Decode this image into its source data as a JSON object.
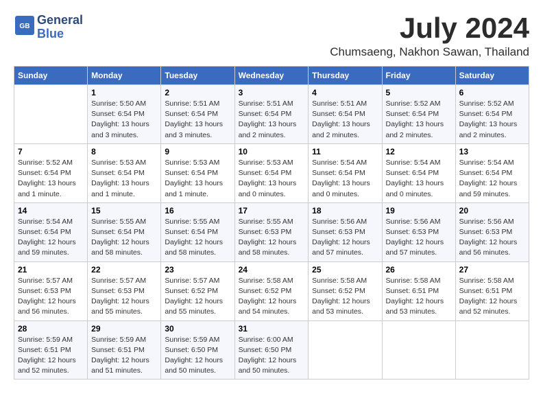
{
  "header": {
    "logo_line1": "General",
    "logo_line2": "Blue",
    "month_year": "July 2024",
    "location": "Chumsaeng, Nakhon Sawan, Thailand"
  },
  "weekdays": [
    "Sunday",
    "Monday",
    "Tuesday",
    "Wednesday",
    "Thursday",
    "Friday",
    "Saturday"
  ],
  "weeks": [
    [
      {
        "day": "",
        "info": ""
      },
      {
        "day": "1",
        "info": "Sunrise: 5:50 AM\nSunset: 6:54 PM\nDaylight: 13 hours\nand 3 minutes."
      },
      {
        "day": "2",
        "info": "Sunrise: 5:51 AM\nSunset: 6:54 PM\nDaylight: 13 hours\nand 3 minutes."
      },
      {
        "day": "3",
        "info": "Sunrise: 5:51 AM\nSunset: 6:54 PM\nDaylight: 13 hours\nand 2 minutes."
      },
      {
        "day": "4",
        "info": "Sunrise: 5:51 AM\nSunset: 6:54 PM\nDaylight: 13 hours\nand 2 minutes."
      },
      {
        "day": "5",
        "info": "Sunrise: 5:52 AM\nSunset: 6:54 PM\nDaylight: 13 hours\nand 2 minutes."
      },
      {
        "day": "6",
        "info": "Sunrise: 5:52 AM\nSunset: 6:54 PM\nDaylight: 13 hours\nand 2 minutes."
      }
    ],
    [
      {
        "day": "7",
        "info": "Sunrise: 5:52 AM\nSunset: 6:54 PM\nDaylight: 13 hours\nand 1 minute."
      },
      {
        "day": "8",
        "info": "Sunrise: 5:53 AM\nSunset: 6:54 PM\nDaylight: 13 hours\nand 1 minute."
      },
      {
        "day": "9",
        "info": "Sunrise: 5:53 AM\nSunset: 6:54 PM\nDaylight: 13 hours\nand 1 minute."
      },
      {
        "day": "10",
        "info": "Sunrise: 5:53 AM\nSunset: 6:54 PM\nDaylight: 13 hours\nand 0 minutes."
      },
      {
        "day": "11",
        "info": "Sunrise: 5:54 AM\nSunset: 6:54 PM\nDaylight: 13 hours\nand 0 minutes."
      },
      {
        "day": "12",
        "info": "Sunrise: 5:54 AM\nSunset: 6:54 PM\nDaylight: 13 hours\nand 0 minutes."
      },
      {
        "day": "13",
        "info": "Sunrise: 5:54 AM\nSunset: 6:54 PM\nDaylight: 12 hours\nand 59 minutes."
      }
    ],
    [
      {
        "day": "14",
        "info": "Sunrise: 5:54 AM\nSunset: 6:54 PM\nDaylight: 12 hours\nand 59 minutes."
      },
      {
        "day": "15",
        "info": "Sunrise: 5:55 AM\nSunset: 6:54 PM\nDaylight: 12 hours\nand 58 minutes."
      },
      {
        "day": "16",
        "info": "Sunrise: 5:55 AM\nSunset: 6:54 PM\nDaylight: 12 hours\nand 58 minutes."
      },
      {
        "day": "17",
        "info": "Sunrise: 5:55 AM\nSunset: 6:53 PM\nDaylight: 12 hours\nand 58 minutes."
      },
      {
        "day": "18",
        "info": "Sunrise: 5:56 AM\nSunset: 6:53 PM\nDaylight: 12 hours\nand 57 minutes."
      },
      {
        "day": "19",
        "info": "Sunrise: 5:56 AM\nSunset: 6:53 PM\nDaylight: 12 hours\nand 57 minutes."
      },
      {
        "day": "20",
        "info": "Sunrise: 5:56 AM\nSunset: 6:53 PM\nDaylight: 12 hours\nand 56 minutes."
      }
    ],
    [
      {
        "day": "21",
        "info": "Sunrise: 5:57 AM\nSunset: 6:53 PM\nDaylight: 12 hours\nand 56 minutes."
      },
      {
        "day": "22",
        "info": "Sunrise: 5:57 AM\nSunset: 6:53 PM\nDaylight: 12 hours\nand 55 minutes."
      },
      {
        "day": "23",
        "info": "Sunrise: 5:57 AM\nSunset: 6:52 PM\nDaylight: 12 hours\nand 55 minutes."
      },
      {
        "day": "24",
        "info": "Sunrise: 5:58 AM\nSunset: 6:52 PM\nDaylight: 12 hours\nand 54 minutes."
      },
      {
        "day": "25",
        "info": "Sunrise: 5:58 AM\nSunset: 6:52 PM\nDaylight: 12 hours\nand 53 minutes."
      },
      {
        "day": "26",
        "info": "Sunrise: 5:58 AM\nSunset: 6:51 PM\nDaylight: 12 hours\nand 53 minutes."
      },
      {
        "day": "27",
        "info": "Sunrise: 5:58 AM\nSunset: 6:51 PM\nDaylight: 12 hours\nand 52 minutes."
      }
    ],
    [
      {
        "day": "28",
        "info": "Sunrise: 5:59 AM\nSunset: 6:51 PM\nDaylight: 12 hours\nand 52 minutes."
      },
      {
        "day": "29",
        "info": "Sunrise: 5:59 AM\nSunset: 6:51 PM\nDaylight: 12 hours\nand 51 minutes."
      },
      {
        "day": "30",
        "info": "Sunrise: 5:59 AM\nSunset: 6:50 PM\nDaylight: 12 hours\nand 50 minutes."
      },
      {
        "day": "31",
        "info": "Sunrise: 6:00 AM\nSunset: 6:50 PM\nDaylight: 12 hours\nand 50 minutes."
      },
      {
        "day": "",
        "info": ""
      },
      {
        "day": "",
        "info": ""
      },
      {
        "day": "",
        "info": ""
      }
    ]
  ]
}
